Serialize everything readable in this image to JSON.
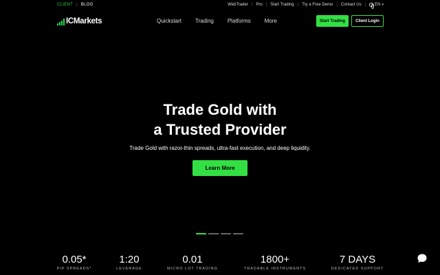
{
  "topbar": {
    "client": "CLIENT",
    "blog": "BLOG",
    "links": [
      "WebTrader",
      "Pro",
      "Start Trading",
      "Try a Free Demo",
      "Contact Us"
    ],
    "language": "EN"
  },
  "nav": {
    "logo": "ICMarkets",
    "menu": [
      "Quickstart",
      "Trading",
      "Platforms",
      "More"
    ],
    "start_trading": "Start Trading",
    "client_login": "Client Login"
  },
  "hero": {
    "title_line1": "Trade Gold with",
    "title_line2": "a Trusted Provider",
    "subtitle": "Trade Gold with razor-thin spreads, ultra-fast execution, and deep liquidity.",
    "cta": "Learn More"
  },
  "slider": {
    "count": 4,
    "active_index": 0
  },
  "stats": [
    {
      "value": "0.05*",
      "label": "PIP SPREADS*"
    },
    {
      "value": "1:20",
      "label": "LEVERAGE"
    },
    {
      "value": "0.01",
      "label": "MICRO LOT TRADING"
    },
    {
      "value": "1800+",
      "label": "TRADABLE INSTRUMENTS"
    },
    {
      "value": "7 DAYS",
      "label": "DEDICATED SUPPORT"
    }
  ],
  "colors": {
    "accent": "#33e044",
    "background": "#000000"
  },
  "icons": {
    "language": "globe-icon",
    "chat": "chat-bubble-icon"
  }
}
